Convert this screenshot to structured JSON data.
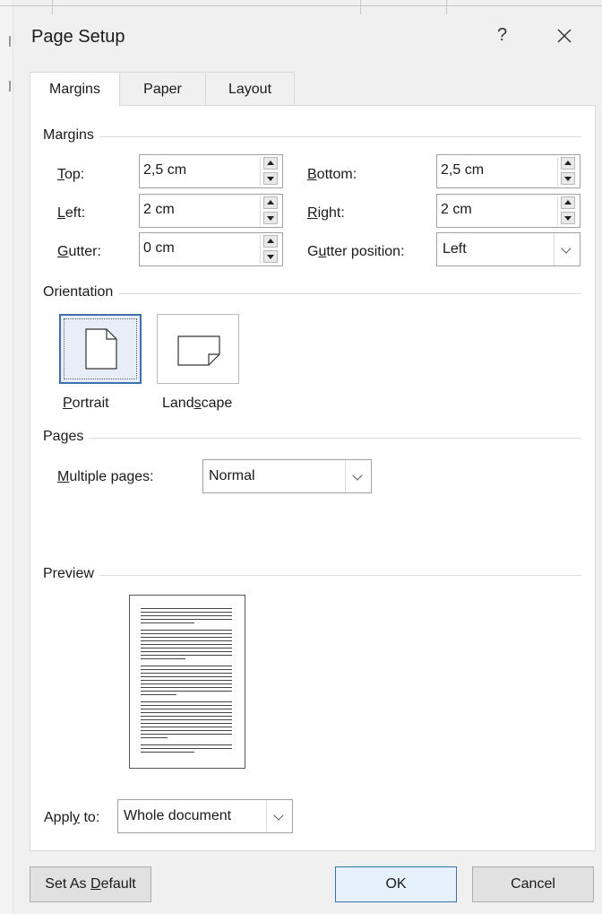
{
  "dialog": {
    "title": "Page Setup",
    "help_label": "?",
    "close_label": "✕"
  },
  "tabs": [
    {
      "label": "Margins",
      "active": true
    },
    {
      "label": "Paper",
      "active": false
    },
    {
      "label": "Layout",
      "active": false
    }
  ],
  "margins": {
    "group_label": "Margins",
    "top": {
      "label_key": "T",
      "label_rest": "op:",
      "value": "2,5 cm"
    },
    "bottom": {
      "label_key": "B",
      "label_rest": "ottom:",
      "value": "2,5 cm"
    },
    "left": {
      "label_key": "L",
      "label_rest": "eft:",
      "value": "2 cm"
    },
    "right": {
      "label_key": "R",
      "label_rest": "ight:",
      "value": "2 cm"
    },
    "gutter": {
      "label_key": "G",
      "label_rest": "utter:",
      "value": "0 cm"
    },
    "gutter_position": {
      "label_pre": "G",
      "label_key": "u",
      "label_rest": "tter position:",
      "value": "Left"
    }
  },
  "orientation": {
    "group_label": "Orientation",
    "portrait": {
      "label_key": "P",
      "label_rest": "ortrait",
      "selected": true
    },
    "landscape": {
      "label_pre": "Land",
      "label_key": "s",
      "label_rest": "cape",
      "selected": false
    }
  },
  "pages": {
    "group_label": "Pages",
    "multiple": {
      "label_key": "M",
      "label_rest": "ultiple pages:",
      "value": "Normal"
    }
  },
  "preview": {
    "group_label": "Preview"
  },
  "apply_to": {
    "label_pre": "Appl",
    "label_key": "y",
    "label_rest": " to:",
    "value": "Whole document"
  },
  "buttons": {
    "default_pre": "Set As ",
    "default_key": "D",
    "default_rest": "efault",
    "ok": "OK",
    "cancel": "Cancel"
  },
  "colors": {
    "accent": "#3c6fae",
    "dialog_bg": "#f0f0f0"
  }
}
